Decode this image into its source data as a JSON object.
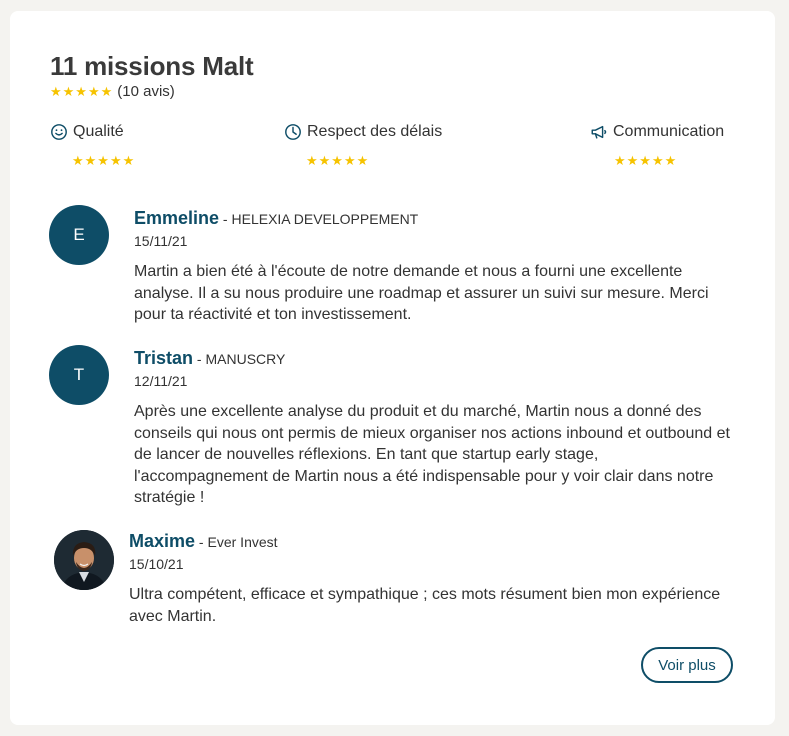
{
  "header": {
    "title": "11 missions Malt",
    "rating_stars": "★★★★★",
    "review_count": "(10 avis)"
  },
  "criteria": [
    {
      "label": "Qualité",
      "icon": "smiley-icon",
      "stars": "★★★★★"
    },
    {
      "label": "Respect des délais",
      "icon": "clock-icon",
      "stars": "★★★★★"
    },
    {
      "label": "Communication",
      "icon": "megaphone-icon",
      "stars": "★★★★★"
    }
  ],
  "reviews": [
    {
      "initial": "E",
      "name": "Emmeline",
      "separator": " - ",
      "company": "HELEXIA DEVELOPPEMENT",
      "date": "15/11/21",
      "text": "Martin a bien été à l'écoute de notre demande et nous a fourni une excellente analyse. Il a su nous produire une roadmap et assurer un suivi sur mesure. Merci pour ta réactivité et ton investissement."
    },
    {
      "initial": "T",
      "name": "Tristan",
      "separator": " - ",
      "company": "MANUSCRY",
      "date": "12/11/21",
      "text": "Après une excellente analyse du produit et du marché, Martin nous a donné des conseils qui nous ont permis de mieux organiser nos actions inbound et outbound et de lancer de nouvelles réflexions. En tant que startup early stage, l'accompagnement de Martin nous a été indispensable pour y voir clair dans notre stratégie !"
    },
    {
      "name": "Maxime",
      "separator": " - ",
      "company": "Ever Invest",
      "date": "15/10/21",
      "text": "Ultra compétent, efficace et sympathique ; ces mots résument bien mon expérience avec Martin."
    }
  ],
  "actions": {
    "more_label": "Voir plus"
  },
  "colors": {
    "accent": "#0e4d67",
    "star": "#f6c300",
    "background": "#f4f3f0"
  }
}
